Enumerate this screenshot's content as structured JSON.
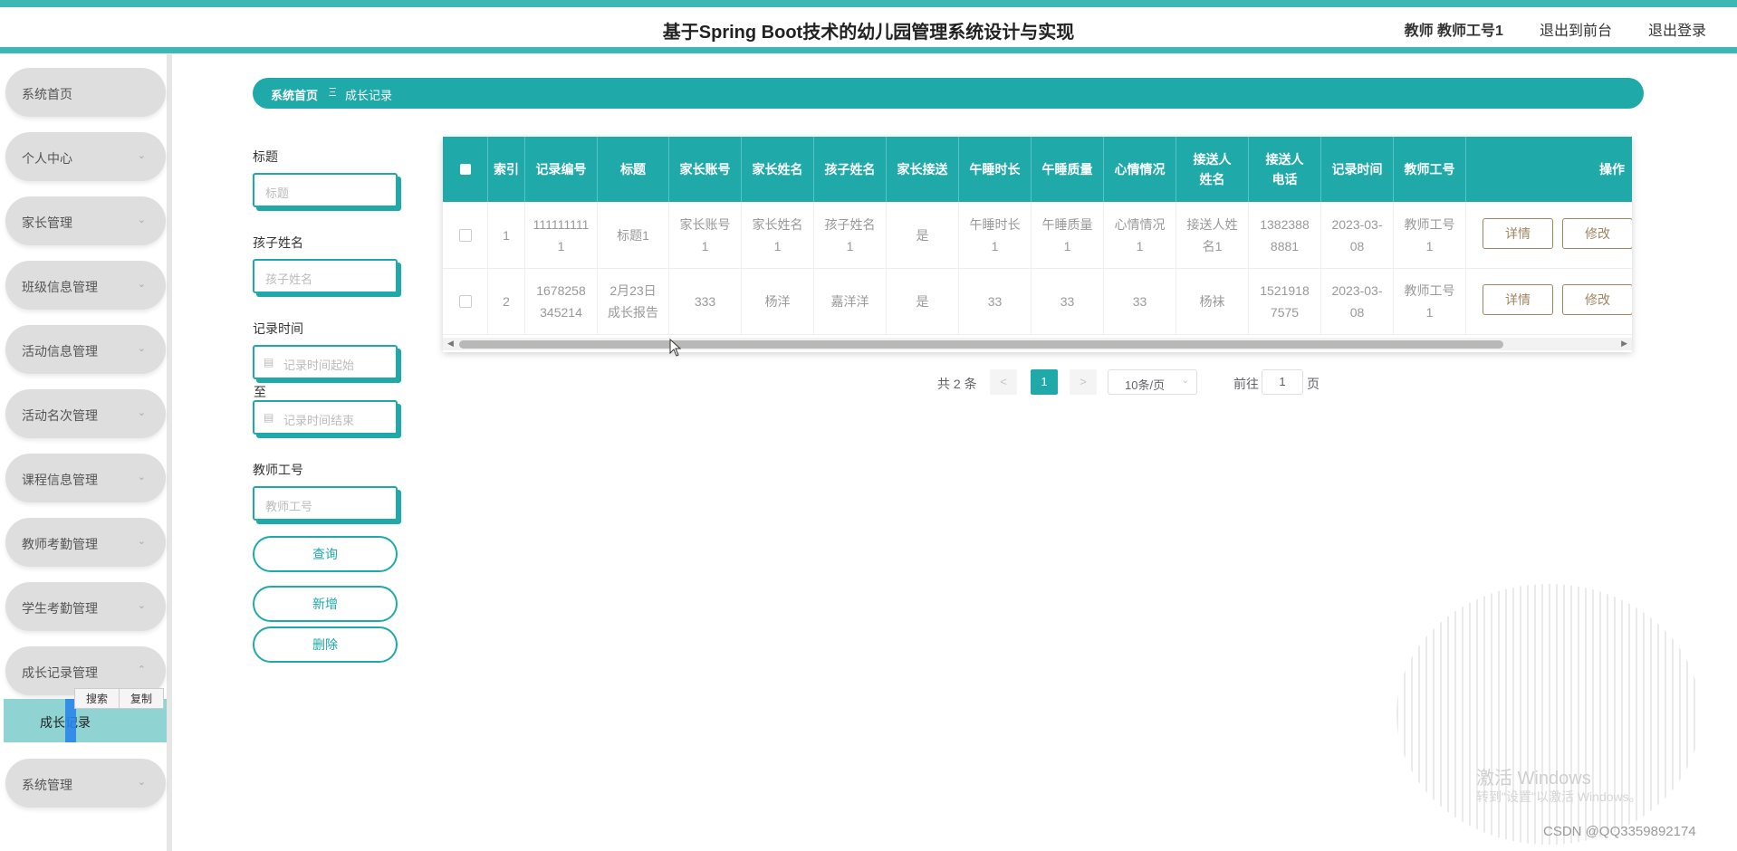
{
  "header": {
    "title": "基于Spring Boot技术的幼儿园管理系统设计与实现",
    "user": "教师 教师工号1",
    "front_link": "退出到前台",
    "logout_link": "退出登录"
  },
  "sidebar": {
    "items": [
      {
        "label": "系统首页",
        "chevron": ""
      },
      {
        "label": "个人中心",
        "chevron": "⌄"
      },
      {
        "label": "家长管理",
        "chevron": "⌄"
      },
      {
        "label": "班级信息管理",
        "chevron": "⌄"
      },
      {
        "label": "活动信息管理",
        "chevron": "⌄"
      },
      {
        "label": "活动名次管理",
        "chevron": "⌄"
      },
      {
        "label": "课程信息管理",
        "chevron": "⌄"
      },
      {
        "label": "教师考勤管理",
        "chevron": "⌄"
      },
      {
        "label": "学生考勤管理",
        "chevron": "⌄"
      },
      {
        "label": "成长记录管理",
        "chevron": "⌃"
      },
      {
        "label": "系统管理",
        "chevron": "⌄"
      }
    ],
    "submenu": {
      "label": "成长记录"
    },
    "context_menu": {
      "search": "搜索",
      "copy": "复制"
    }
  },
  "breadcrumb": {
    "home": "系统首页",
    "separator": "Ξ",
    "current": "成长记录"
  },
  "search": {
    "title_label": "标题",
    "title_placeholder": "标题",
    "child_label": "孩子姓名",
    "child_placeholder": "孩子姓名",
    "time_label": "记录时间",
    "time_start_placeholder": "记录时间起始",
    "to_label": "至",
    "time_end_placeholder": "记录时间结束",
    "teacher_label": "教师工号",
    "teacher_placeholder": "教师工号",
    "query_button": "查询",
    "add_button": "新增",
    "delete_button": "删除"
  },
  "table": {
    "headers": [
      "索引",
      "记录编号",
      "标题",
      "家长账号",
      "家长姓名",
      "孩子姓名",
      "家长接送",
      "午睡时长",
      "午睡质量",
      "心情情况",
      "接送人姓名",
      "接送人电话",
      "记录时间",
      "教师工号",
      "操作"
    ],
    "rows": [
      [
        "1",
        "1111111111",
        "标题1",
        "家长账号1",
        "家长姓名1",
        "孩子姓名1",
        "是",
        "午睡时长1",
        "午睡质量1",
        "心情情况1",
        "接送人姓名1",
        "13823888881",
        "2023-03-08",
        "教师工号1"
      ],
      [
        "2",
        "1678258345214",
        "2月23日成长报告",
        "333",
        "杨洋",
        "嘉洋洋",
        "是",
        "33",
        "33",
        "33",
        "杨袜",
        "15219187575",
        "2023-03-08",
        "教师工号1"
      ]
    ],
    "detail_button": "详情",
    "edit_button": "修改"
  },
  "pagination": {
    "total": "共 2 条",
    "prev": "<",
    "current_page": "1",
    "next": ">",
    "page_size": "10条/页",
    "goto_label": "前往",
    "goto_value": "1",
    "page_suffix": "页"
  },
  "watermark": {
    "line1": "激活 Windows",
    "line2": "转到\"设置\"以激活 Windows。",
    "csdn": "CSDN @QQ3359892174"
  },
  "colors": {
    "accent": "#1fa9a9",
    "stripe": "#3db6b6",
    "action": "#a08560",
    "sidebar_item": "#dedede",
    "submenu_active": "#8fd3d3"
  }
}
